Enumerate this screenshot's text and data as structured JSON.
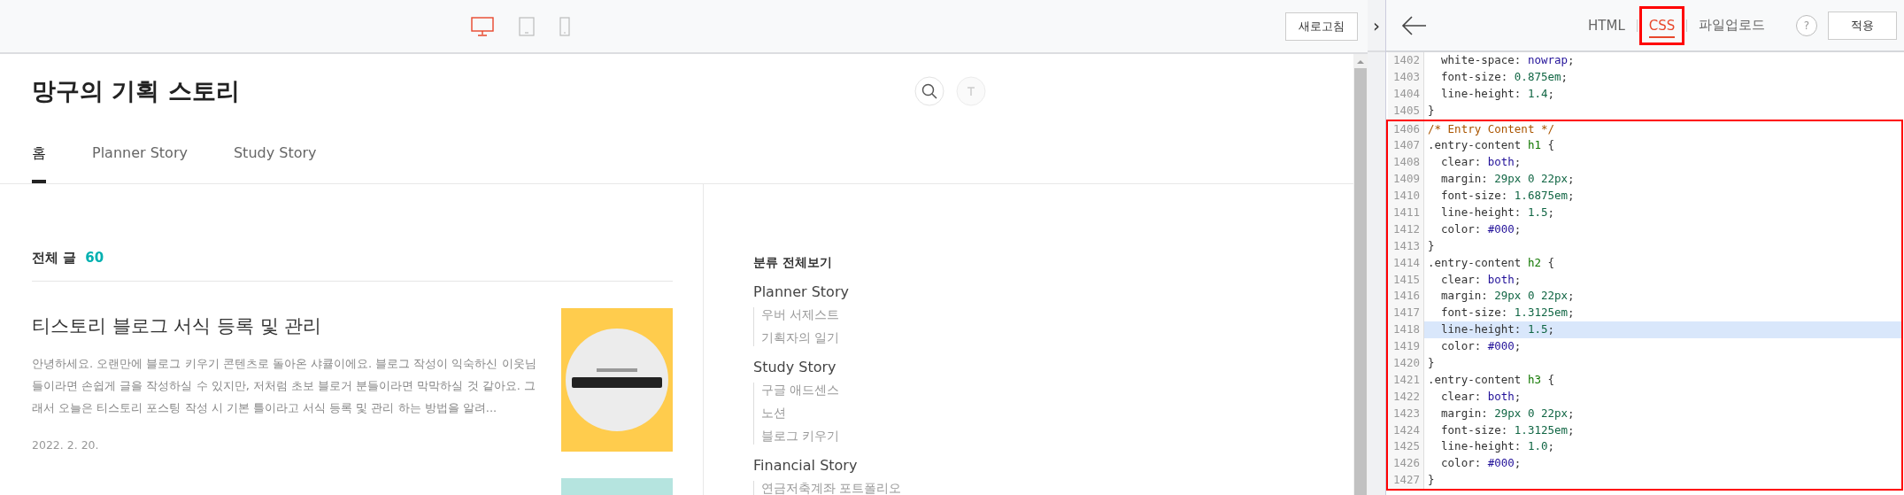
{
  "toolbar": {
    "devices": [
      {
        "kind": "desktop",
        "selected": true
      },
      {
        "kind": "tablet",
        "selected": false
      },
      {
        "kind": "mobile",
        "selected": false
      }
    ],
    "refresh_button": "새로고침",
    "collapse_button": "›"
  },
  "blog": {
    "title": "망구의 기획 스토리",
    "nav": [
      {
        "label": "홈",
        "selected": true
      },
      {
        "label": "Planner Story",
        "selected": false
      },
      {
        "label": "Study Story",
        "selected": false
      }
    ],
    "post_list": {
      "heading": "전체 글",
      "count": "60",
      "posts": [
        {
          "title": "티스토리 블로그 서식 등록 및 관리",
          "excerpt": "안녕하세요. 오랜만에 블로그 키우기 콘텐츠로 돌아온 샤큘이에요. 블로그 작성이 익숙하신 이웃님들이라면 손쉽게 글을 작성하실 수 있지만, 저처럼 초보 블로거 분들이라면 막막하실 것 같아요. 그래서 오늘은 티스토리 포스팅 작성 시 기본 틀이라고 서식 등록 및 관리 하는 방법을 알려...",
          "date": "2022. 2. 20.",
          "thumbnail": {
            "kind": "picture",
            "color": "#ffcc4d"
          }
        },
        {
          "thumbnail": {
            "kind": "picture",
            "color": "#b5e4df"
          }
        }
      ]
    },
    "categories": {
      "heading": "분류 전체보기",
      "groups": [
        {
          "label": "Planner Story",
          "children": [
            {
              "label": "우버 서제스트"
            },
            {
              "label": "기획자의 일기"
            }
          ]
        },
        {
          "label": "Study Story",
          "children": [
            {
              "label": "구글 애드센스"
            },
            {
              "label": "노션"
            },
            {
              "label": "블로그 키우기"
            }
          ]
        },
        {
          "label": "Financial Story",
          "children": [
            {
              "label": "연금저축계좌 포트폴리오"
            }
          ]
        }
      ]
    }
  },
  "editor": {
    "tabs": [
      {
        "label": "HTML",
        "selected": false,
        "boxed": false
      },
      {
        "label": "CSS",
        "selected": true,
        "boxed": true
      },
      {
        "label": "파일업로드",
        "selected": false,
        "boxed": false
      }
    ],
    "help": "?",
    "apply_button": "적용",
    "sections": [
      {
        "boxed": false,
        "lines": [
          {
            "number": "1402",
            "boxed": false,
            "highlighted": false,
            "tokens": [
              {
                "text": "  white-space: ",
                "kind": "plain"
              },
              {
                "text": "nowrap",
                "kind": "keyword"
              },
              {
                "text": ";",
                "kind": "plain"
              }
            ]
          },
          {
            "number": "1403",
            "boxed": false,
            "highlighted": false,
            "tokens": [
              {
                "text": "  font-size: ",
                "kind": "plain"
              },
              {
                "text": "0.875em",
                "kind": "number"
              },
              {
                "text": ";",
                "kind": "plain"
              }
            ]
          },
          {
            "number": "1404",
            "boxed": false,
            "highlighted": false,
            "tokens": [
              {
                "text": "  line-height: ",
                "kind": "plain"
              },
              {
                "text": "1.4",
                "kind": "number"
              },
              {
                "text": ";",
                "kind": "plain"
              }
            ]
          },
          {
            "number": "1405",
            "boxed": false,
            "highlighted": false,
            "tokens": [
              {
                "text": "}",
                "kind": "plain"
              }
            ]
          }
        ]
      },
      {
        "boxed": true,
        "lines": [
          {
            "number": "1406",
            "boxed": true,
            "highlighted": false,
            "tokens": [
              {
                "text": "/* Entry Content */",
                "kind": "comment"
              }
            ]
          },
          {
            "number": "1407",
            "boxed": true,
            "highlighted": false,
            "tokens": [
              {
                "text": ".entry-content ",
                "kind": "plain"
              },
              {
                "text": "h1",
                "kind": "tag"
              },
              {
                "text": " {",
                "kind": "plain"
              }
            ]
          },
          {
            "number": "1408",
            "boxed": true,
            "highlighted": false,
            "tokens": [
              {
                "text": "  clear: ",
                "kind": "plain"
              },
              {
                "text": "both",
                "kind": "keyword"
              },
              {
                "text": ";",
                "kind": "plain"
              }
            ]
          },
          {
            "number": "1409",
            "boxed": true,
            "highlighted": false,
            "tokens": [
              {
                "text": "  margin: ",
                "kind": "plain"
              },
              {
                "text": "29px 0 22px",
                "kind": "number"
              },
              {
                "text": ";",
                "kind": "plain"
              }
            ]
          },
          {
            "number": "1410",
            "boxed": true,
            "highlighted": false,
            "tokens": [
              {
                "text": "  font-size: ",
                "kind": "plain"
              },
              {
                "text": "1.6875em",
                "kind": "number"
              },
              {
                "text": ";",
                "kind": "plain"
              }
            ]
          },
          {
            "number": "1411",
            "boxed": true,
            "highlighted": false,
            "tokens": [
              {
                "text": "  line-height: ",
                "kind": "plain"
              },
              {
                "text": "1.5",
                "kind": "number"
              },
              {
                "text": ";",
                "kind": "plain"
              }
            ]
          },
          {
            "number": "1412",
            "boxed": true,
            "highlighted": false,
            "tokens": [
              {
                "text": "  color: ",
                "kind": "plain"
              },
              {
                "text": "#000",
                "kind": "keyword"
              },
              {
                "text": ";",
                "kind": "plain"
              }
            ]
          },
          {
            "number": "1413",
            "boxed": true,
            "highlighted": false,
            "tokens": [
              {
                "text": "}",
                "kind": "plain"
              }
            ]
          },
          {
            "number": "1414",
            "boxed": true,
            "highlighted": false,
            "tokens": [
              {
                "text": ".entry-content ",
                "kind": "plain"
              },
              {
                "text": "h2",
                "kind": "tag"
              },
              {
                "text": " {",
                "kind": "plain"
              }
            ]
          },
          {
            "number": "1415",
            "boxed": true,
            "highlighted": false,
            "tokens": [
              {
                "text": "  clear: ",
                "kind": "plain"
              },
              {
                "text": "both",
                "kind": "keyword"
              },
              {
                "text": ";",
                "kind": "plain"
              }
            ]
          },
          {
            "number": "1416",
            "boxed": true,
            "highlighted": false,
            "tokens": [
              {
                "text": "  margin: ",
                "kind": "plain"
              },
              {
                "text": "29px 0 22px",
                "kind": "number"
              },
              {
                "text": ";",
                "kind": "plain"
              }
            ]
          },
          {
            "number": "1417",
            "boxed": true,
            "highlighted": false,
            "tokens": [
              {
                "text": "  font-size: ",
                "kind": "plain"
              },
              {
                "text": "1.3125em",
                "kind": "number"
              },
              {
                "text": ";",
                "kind": "plain"
              }
            ]
          },
          {
            "number": "1418",
            "boxed": true,
            "highlighted": true,
            "tokens": [
              {
                "text": "  line-height: ",
                "kind": "plain"
              },
              {
                "text": "1.5",
                "kind": "number"
              },
              {
                "text": ";",
                "kind": "plain"
              }
            ]
          },
          {
            "number": "1419",
            "boxed": true,
            "highlighted": false,
            "tokens": [
              {
                "text": "  color: ",
                "kind": "plain"
              },
              {
                "text": "#000",
                "kind": "keyword"
              },
              {
                "text": ";",
                "kind": "plain"
              }
            ]
          },
          {
            "number": "1420",
            "boxed": true,
            "highlighted": false,
            "tokens": [
              {
                "text": "}",
                "kind": "plain"
              }
            ]
          },
          {
            "number": "1421",
            "boxed": true,
            "highlighted": false,
            "tokens": [
              {
                "text": ".entry-content ",
                "kind": "plain"
              },
              {
                "text": "h3",
                "kind": "tag"
              },
              {
                "text": " {",
                "kind": "plain"
              }
            ]
          },
          {
            "number": "1422",
            "boxed": true,
            "highlighted": false,
            "tokens": [
              {
                "text": "  clear: ",
                "kind": "plain"
              },
              {
                "text": "both",
                "kind": "keyword"
              },
              {
                "text": ";",
                "kind": "plain"
              }
            ]
          },
          {
            "number": "1423",
            "boxed": true,
            "highlighted": false,
            "tokens": [
              {
                "text": "  margin: ",
                "kind": "plain"
              },
              {
                "text": "29px 0 22px",
                "kind": "number"
              },
              {
                "text": ";",
                "kind": "plain"
              }
            ]
          },
          {
            "number": "1424",
            "boxed": true,
            "highlighted": false,
            "tokens": [
              {
                "text": "  font-size: ",
                "kind": "plain"
              },
              {
                "text": "1.3125em",
                "kind": "number"
              },
              {
                "text": ";",
                "kind": "plain"
              }
            ]
          },
          {
            "number": "1425",
            "boxed": true,
            "highlighted": false,
            "tokens": [
              {
                "text": "  line-height: ",
                "kind": "plain"
              },
              {
                "text": "1.0",
                "kind": "number"
              },
              {
                "text": ";",
                "kind": "plain"
              }
            ]
          },
          {
            "number": "1426",
            "boxed": true,
            "highlighted": false,
            "tokens": [
              {
                "text": "  color: ",
                "kind": "plain"
              },
              {
                "text": "#000",
                "kind": "keyword"
              },
              {
                "text": ";",
                "kind": "plain"
              }
            ]
          },
          {
            "number": "1427",
            "boxed": true,
            "highlighted": false,
            "tokens": [
              {
                "text": "}",
                "kind": "plain"
              }
            ]
          }
        ]
      }
    ]
  }
}
